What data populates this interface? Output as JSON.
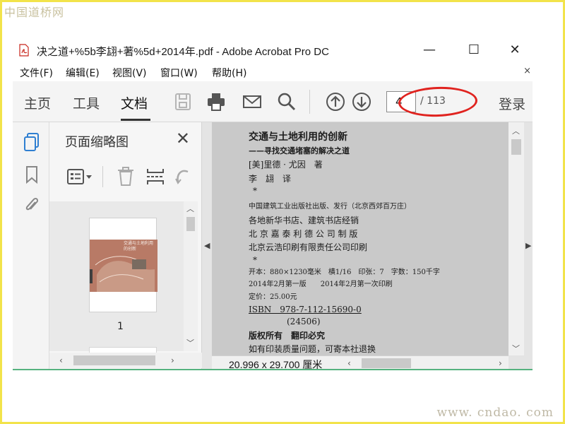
{
  "watermark": {
    "top_left": "中国道桥网",
    "bottom_right": "www. cndao. com"
  },
  "window": {
    "title": "决之道+%5b李翃+著%5d+2014年.pdf - Adobe Acrobat Pro DC",
    "buttons": {
      "minimize": "—",
      "maximize": "☐",
      "close": "✕"
    }
  },
  "menu": {
    "items": [
      "文件(F)",
      "编辑(E)",
      "视图(V)",
      "窗口(W)",
      "帮助(H)"
    ],
    "close": "×"
  },
  "toolbar": {
    "tabs": [
      "主页",
      "工具",
      "文档"
    ],
    "active_tab": "文档",
    "icons": [
      "save-icon",
      "print-icon",
      "mail-icon",
      "search-icon",
      "page-up-icon",
      "page-down-icon"
    ],
    "page_current": "4",
    "page_total": "/ 113",
    "login": "登录"
  },
  "sidebar": {
    "icons": [
      "page-thumbnails-icon",
      "bookmark-icon",
      "attachment-icon"
    ]
  },
  "thumbnails": {
    "title": "页面缩略图",
    "close": "✕",
    "pages": [
      {
        "number": "1",
        "cover_title": "交通与土地利用的创新"
      }
    ]
  },
  "document": {
    "lines": [
      "交通与土地利用的创新",
      "——寻找交通堵塞的解决之道",
      "[美]里德 · 尤因　著",
      "李　翃　译",
      "*",
      "中国建筑工业出版社出版、发行（北京西郊百万庄）",
      "各地新华书店、建筑书店经销",
      "北 京 嘉 泰 利 德 公 司 制 版",
      "北京云浩印刷有限责任公司印刷",
      "*",
      "开本：880×1230毫米　横1/16　印张：7　字数：150千字",
      "2014年2月第一版　　2014年2月第一次印刷",
      "定价：25.00元",
      "ISBN　978-7-112-15690-0",
      "(24506)",
      "版权所有　翻印必究",
      "如有印装质量问题，可寄本社退换"
    ],
    "page_size": "20.996 x 29.700 厘米"
  },
  "colors": {
    "accent_oval": "#e0231f",
    "frame": "#f2e34a",
    "green_line": "#56b27f"
  }
}
